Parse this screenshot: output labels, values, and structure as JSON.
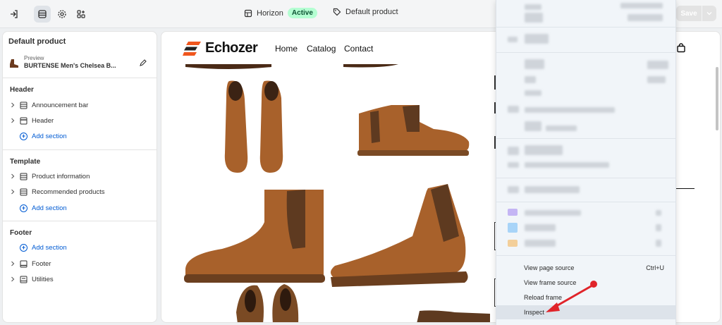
{
  "topbar": {
    "theme_name": "Horizon",
    "theme_status": "Active",
    "template_name": "Default product",
    "save_label": "Save"
  },
  "sidebar": {
    "title": "Default product",
    "preview_label": "Preview",
    "preview_product": "BURTENSE Men's Chelsea B...",
    "groups": [
      {
        "title": "Header",
        "items": [
          "Announcement bar",
          "Header"
        ],
        "add": "Add section"
      },
      {
        "title": "Template",
        "items": [
          "Product information",
          "Recommended products"
        ],
        "add": "Add section"
      },
      {
        "title": "Footer",
        "add": "Add section",
        "items": [
          "Footer",
          "Utilities"
        ]
      }
    ]
  },
  "store": {
    "logo": "Echozer",
    "nav": [
      "Home",
      "Catalog",
      "Contact"
    ]
  },
  "context_menu": {
    "items": [
      {
        "label": "View page source",
        "shortcut": "Ctrl+U"
      },
      {
        "label": "View frame source",
        "shortcut": ""
      },
      {
        "label": "Reload frame",
        "shortcut": ""
      },
      {
        "label": "Inspect",
        "shortcut": ""
      }
    ]
  },
  "colors": {
    "accent_blue": "#005bd3",
    "active_badge": "#b4fed2",
    "logo_orange": "#f0561d",
    "boot_brown": "#a8612b",
    "arrow_red": "#e0242a"
  }
}
